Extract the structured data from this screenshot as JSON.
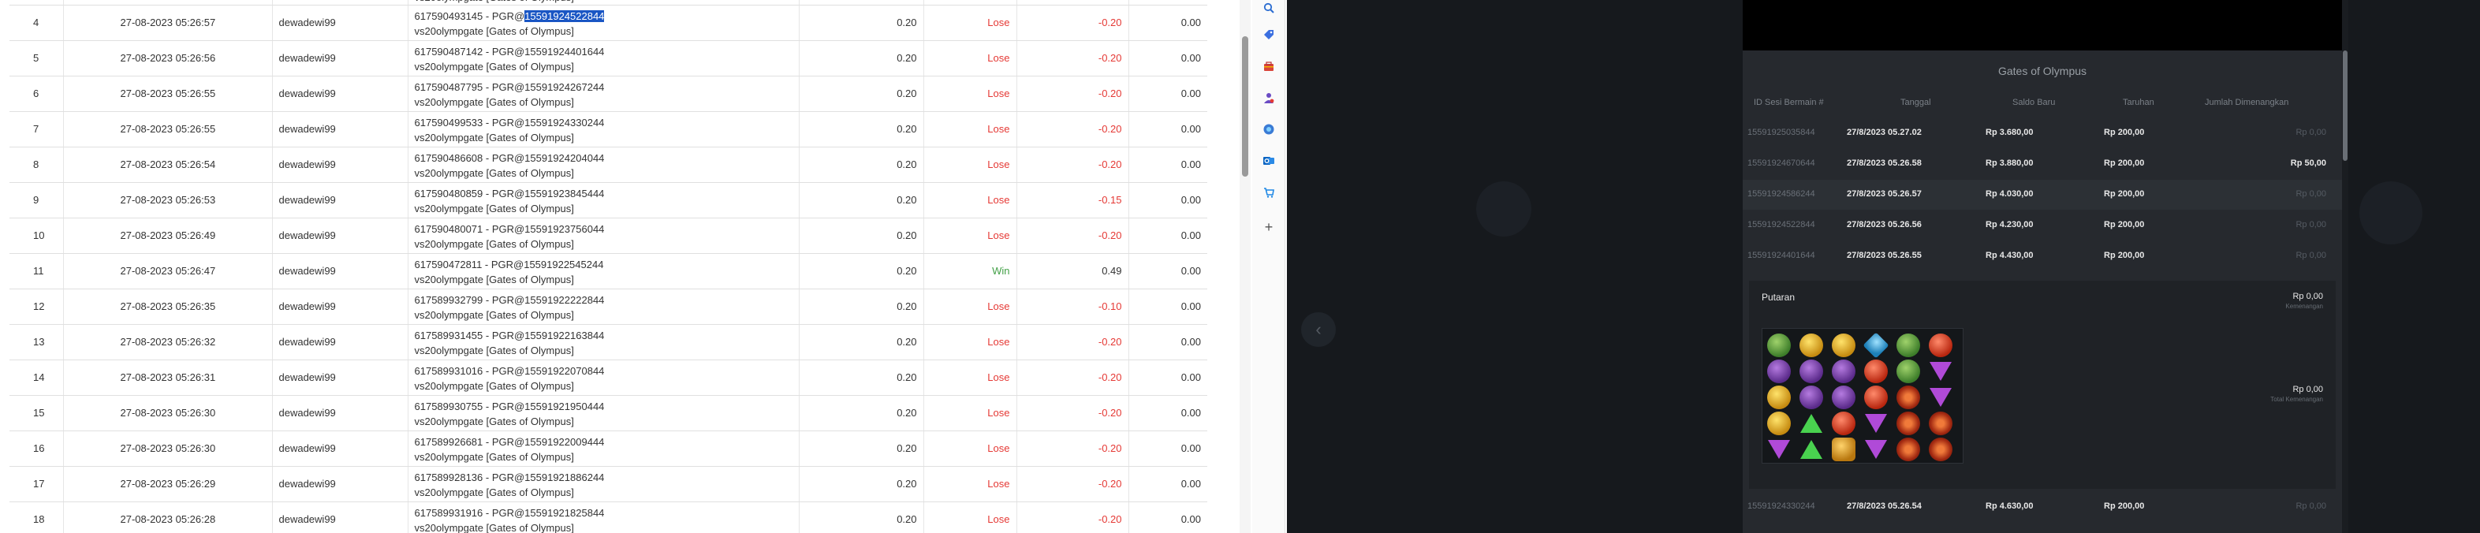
{
  "table": {
    "rows": [
      {
        "no": "4",
        "date": "27-08-2023 05:26:57",
        "user": "dewadewi99",
        "desc_prefix": "617590493145 - PGR@",
        "desc_highlight": "15591924522844",
        "desc_line2": "vs20olympgate [Gates of Olympus]",
        "bet": "0.20",
        "result": "Lose",
        "pl": "-0.20",
        "bal": "0.00"
      },
      {
        "no": "5",
        "date": "27-08-2023 05:26:56",
        "user": "dewadewi99",
        "desc_prefix": "617590487142 - PGR@15591924401644",
        "desc_highlight": "",
        "desc_line2": "vs20olympgate [Gates of Olympus]",
        "bet": "0.20",
        "result": "Lose",
        "pl": "-0.20",
        "bal": "0.00"
      },
      {
        "no": "6",
        "date": "27-08-2023 05:26:55",
        "user": "dewadewi99",
        "desc_prefix": "617590487795 - PGR@15591924267244",
        "desc_highlight": "",
        "desc_line2": "vs20olympgate [Gates of Olympus]",
        "bet": "0.20",
        "result": "Lose",
        "pl": "-0.20",
        "bal": "0.00"
      },
      {
        "no": "7",
        "date": "27-08-2023 05:26:55",
        "user": "dewadewi99",
        "desc_prefix": "617590499533 - PGR@15591924330244",
        "desc_highlight": "",
        "desc_line2": "vs20olympgate [Gates of Olympus]",
        "bet": "0.20",
        "result": "Lose",
        "pl": "-0.20",
        "bal": "0.00"
      },
      {
        "no": "8",
        "date": "27-08-2023 05:26:54",
        "user": "dewadewi99",
        "desc_prefix": "617590486608 - PGR@15591924204044",
        "desc_highlight": "",
        "desc_line2": "vs20olympgate [Gates of Olympus]",
        "bet": "0.20",
        "result": "Lose",
        "pl": "-0.20",
        "bal": "0.00"
      },
      {
        "no": "9",
        "date": "27-08-2023 05:26:53",
        "user": "dewadewi99",
        "desc_prefix": "617590480859 - PGR@15591923845444",
        "desc_highlight": "",
        "desc_line2": "vs20olympgate [Gates of Olympus]",
        "bet": "0.20",
        "result": "Lose",
        "pl": "-0.15",
        "bal": "0.00"
      },
      {
        "no": "10",
        "date": "27-08-2023 05:26:49",
        "user": "dewadewi99",
        "desc_prefix": "617590480071 - PGR@15591923756044",
        "desc_highlight": "",
        "desc_line2": "vs20olympgate [Gates of Olympus]",
        "bet": "0.20",
        "result": "Lose",
        "pl": "-0.20",
        "bal": "0.00"
      },
      {
        "no": "11",
        "date": "27-08-2023 05:26:47",
        "user": "dewadewi99",
        "desc_prefix": "617590472811 - PGR@15591922545244",
        "desc_highlight": "",
        "desc_line2": "vs20olympgate [Gates of Olympus]",
        "bet": "0.20",
        "result": "Win",
        "pl": "0.49",
        "bal": "0.00"
      },
      {
        "no": "12",
        "date": "27-08-2023 05:26:35",
        "user": "dewadewi99",
        "desc_prefix": "617589932799 - PGR@15591922222844",
        "desc_highlight": "",
        "desc_line2": "vs20olympgate [Gates of Olympus]",
        "bet": "0.20",
        "result": "Lose",
        "pl": "-0.10",
        "bal": "0.00"
      },
      {
        "no": "13",
        "date": "27-08-2023 05:26:32",
        "user": "dewadewi99",
        "desc_prefix": "617589931455 - PGR@15591922163844",
        "desc_highlight": "",
        "desc_line2": "vs20olympgate [Gates of Olympus]",
        "bet": "0.20",
        "result": "Lose",
        "pl": "-0.20",
        "bal": "0.00"
      },
      {
        "no": "14",
        "date": "27-08-2023 05:26:31",
        "user": "dewadewi99",
        "desc_prefix": "617589931016 - PGR@15591922070844",
        "desc_highlight": "",
        "desc_line2": "vs20olympgate [Gates of Olympus]",
        "bet": "0.20",
        "result": "Lose",
        "pl": "-0.20",
        "bal": "0.00"
      },
      {
        "no": "15",
        "date": "27-08-2023 05:26:30",
        "user": "dewadewi99",
        "desc_prefix": "617589930755 - PGR@15591921950444",
        "desc_highlight": "",
        "desc_line2": "vs20olympgate [Gates of Olympus]",
        "bet": "0.20",
        "result": "Lose",
        "pl": "-0.20",
        "bal": "0.00"
      },
      {
        "no": "16",
        "date": "27-08-2023 05:26:30",
        "user": "dewadewi99",
        "desc_prefix": "617589926681 - PGR@15591922009444",
        "desc_highlight": "",
        "desc_line2": "vs20olympgate [Gates of Olympus]",
        "bet": "0.20",
        "result": "Lose",
        "pl": "-0.20",
        "bal": "0.00"
      },
      {
        "no": "17",
        "date": "27-08-2023 05:26:29",
        "user": "dewadewi99",
        "desc_prefix": "617589928136 - PGR@15591921886244",
        "desc_highlight": "",
        "desc_line2": "vs20olympgate [Gates of Olympus]",
        "bet": "0.20",
        "result": "Lose",
        "pl": "-0.20",
        "bal": "0.00"
      },
      {
        "no": "18",
        "date": "27-08-2023 05:26:28",
        "user": "dewadewi99",
        "desc_prefix": "617589931916 - PGR@15591921825844",
        "desc_highlight": "",
        "desc_line2": "vs20olympgate [Gates of Olympus]",
        "bet": "0.20",
        "result": "Lose",
        "pl": "-0.20",
        "bal": "0.00"
      }
    ],
    "top_partial_text": "vs20olympgate [Gates of Olympus]"
  },
  "sidebar_icons": [
    "search-icon",
    "tag-icon",
    "toolbox-icon",
    "person-icon",
    "copilot-icon",
    "outlook-icon",
    "shopping-icon",
    "add-icon"
  ],
  "game": {
    "title": "Gates of Olympus",
    "headers": {
      "id": "ID Sesi Bermain #",
      "tanggal": "Tanggal",
      "saldo": "Saldo Baru",
      "taruhan": "Taruhan",
      "jumlah": "Jumlah Dimenangkan"
    },
    "rows": [
      {
        "id": "15591925035844",
        "tanggal": "27/8/2023 05.27.02",
        "saldo": "Rp 3.680,00",
        "taruhan": "Rp 200,00",
        "jumlah": "Rp 0,00",
        "zero": true
      },
      {
        "id": "15591924670644",
        "tanggal": "27/8/2023 05.26.58",
        "saldo": "Rp 3.880,00",
        "taruhan": "Rp 200,00",
        "jumlah": "Rp 50,00",
        "zero": false
      },
      {
        "id": "15591924586244",
        "tanggal": "27/8/2023 05.26.57",
        "saldo": "Rp 4.030,00",
        "taruhan": "Rp 200,00",
        "jumlah": "Rp 0,00",
        "zero": true
      },
      {
        "id": "15591924522844",
        "tanggal": "27/8/2023 05.26.56",
        "saldo": "Rp 4.230,00",
        "taruhan": "Rp 200,00",
        "jumlah": "Rp 0,00",
        "zero": true
      },
      {
        "id": "15591924401644",
        "tanggal": "27/8/2023 05.26.55",
        "saldo": "Rp 4.430,00",
        "taruhan": "Rp 200,00",
        "jumlah": "Rp 0,00",
        "zero": true
      }
    ],
    "detail": {
      "putaran_label": "Putaran",
      "putaran_amount": "Rp 0,00",
      "putaran_sub": "Kemenangan",
      "total_amount": "Rp 0,00",
      "total_sub": "Total Kemenangan"
    },
    "last_row": {
      "id": "15591924330244",
      "tanggal": "27/8/2023 05.26.54",
      "saldo": "Rp 4.630,00",
      "taruhan": "Rp 200,00",
      "jumlah": "Rp 0,00",
      "zero": true
    },
    "symbols": [
      [
        "green",
        "yellow",
        "yellow",
        "blue",
        "green",
        "red"
      ],
      [
        "purple",
        "purple",
        "purple",
        "red",
        "green",
        "tri-purple"
      ],
      [
        "yellow",
        "purple",
        "purple",
        "red",
        "redring",
        "tri-purple"
      ],
      [
        "yellow",
        "tri-green",
        "red",
        "tri-purple",
        "redring",
        "redring"
      ],
      [
        "tri-purple",
        "tri-green",
        "gold",
        "tri-purple",
        "redring",
        "redring"
      ]
    ]
  }
}
